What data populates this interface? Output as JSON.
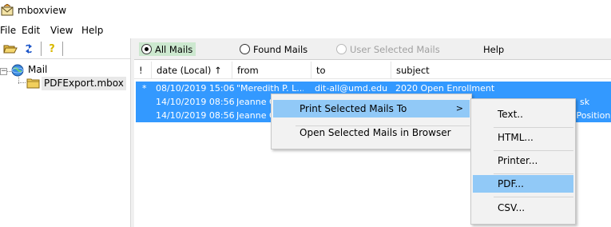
{
  "window": {
    "title": "mboxview"
  },
  "menubar": [
    "File",
    "Edit",
    "View",
    "Help"
  ],
  "toolbar": {
    "help_glyph": "?"
  },
  "tree": {
    "root": "Mail",
    "child": "PDFExport.mbox"
  },
  "radiobar": {
    "all_mails": "All Mails",
    "found_mails": "Found Mails",
    "user_selected": "User Selected Mails",
    "help": "Help"
  },
  "grid": {
    "columns": [
      "!",
      "date (Local) ↑",
      "from",
      "to",
      "subject"
    ],
    "rows": [
      {
        "flag": "*",
        "date": "08/10/2019 15:06",
        "from": "\"Meredith P. L...",
        "to": "dit-all@umd.edu",
        "subject": "2020 Open Enrollment"
      },
      {
        "flag": "",
        "date": "14/10/2019 08:56",
        "from": "Jeanne G",
        "to": "",
        "subject": "sk"
      },
      {
        "flag": "",
        "date": "14/10/2019 08:56",
        "from": "Jeanne G",
        "to": "",
        "subject": "h Position"
      }
    ]
  },
  "context_menu": {
    "print_selected": "Print Selected Mails To",
    "print_arrow": ">",
    "open_browser": "Open Selected Mails in Browser"
  },
  "submenu": [
    "Text..",
    "HTML...",
    "Printer...",
    "PDF...",
    "CSV..."
  ],
  "colors": {
    "selection": "#3399ff",
    "menu_highlight": "#91c9f7",
    "radio_selected": "#cce8cf"
  }
}
